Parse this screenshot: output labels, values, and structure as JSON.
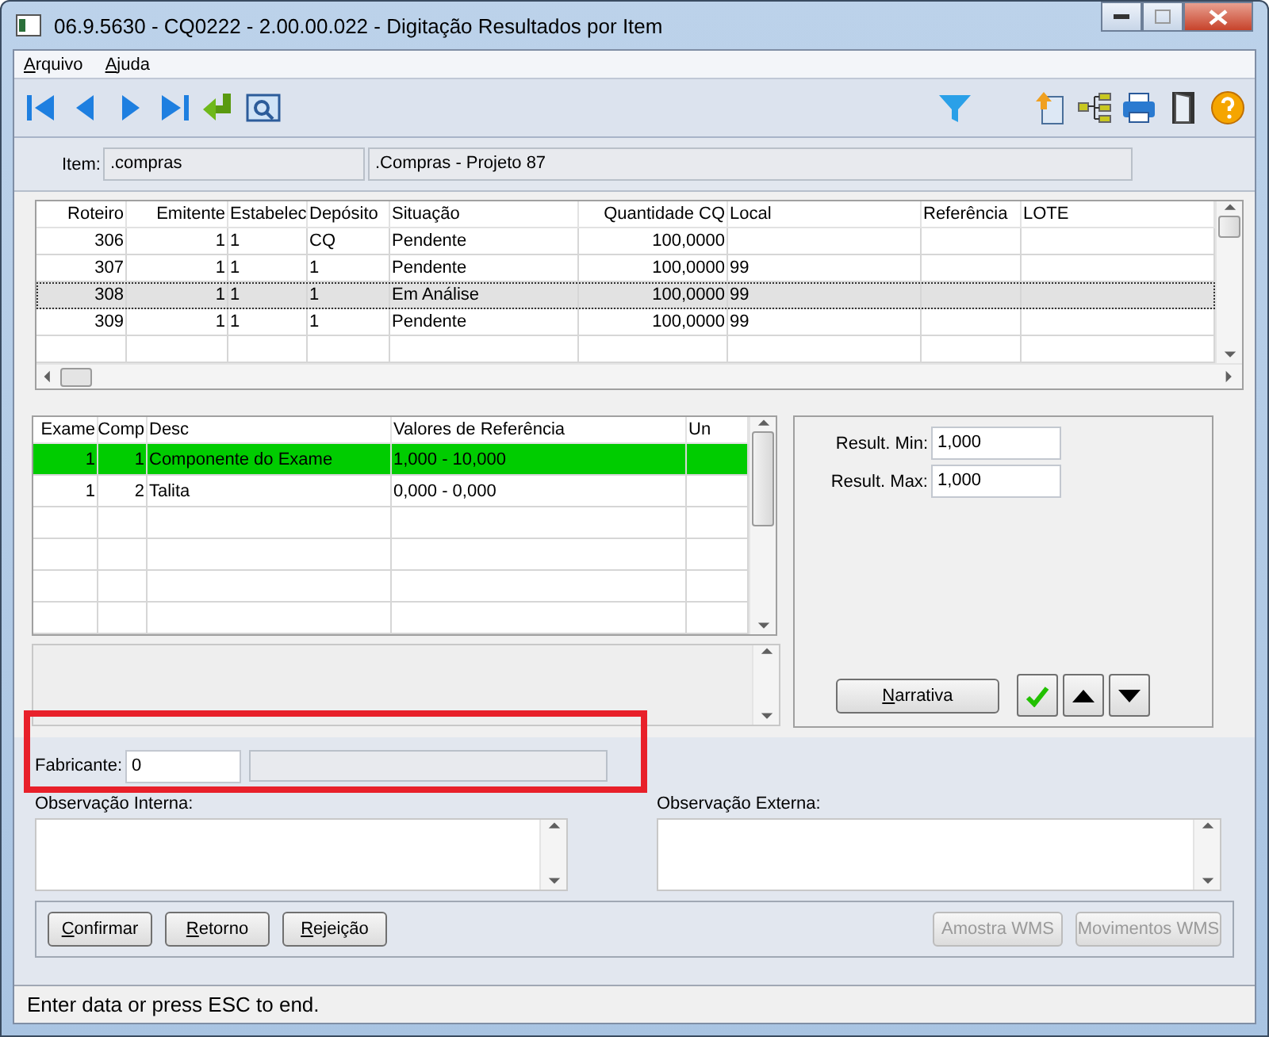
{
  "window": {
    "title": "06.9.5630 - CQ0222 - 2.00.00.022 - Digitação Resultados por Item"
  },
  "menu": [
    {
      "label": "Arquivo"
    },
    {
      "label": "Ajuda"
    }
  ],
  "item": {
    "label": "Item:",
    "code": ".compras",
    "description": ".Compras - Projeto 87"
  },
  "routes_table": {
    "columns": [
      {
        "label": "Roteiro",
        "kind": "number"
      },
      {
        "label": "Emitente",
        "kind": "number"
      },
      {
        "label": "Estabelec",
        "kind": "text"
      },
      {
        "label": "Depósito",
        "kind": "text"
      },
      {
        "label": "Situação",
        "kind": "text"
      },
      {
        "label": "Quantidade CQ",
        "kind": "number"
      },
      {
        "label": "Local",
        "kind": "text"
      },
      {
        "label": "Referência",
        "kind": "text"
      },
      {
        "label": "LOTE",
        "kind": "text"
      }
    ],
    "rows": [
      {
        "cells": [
          "306",
          "1",
          "1",
          "CQ",
          "Pendente",
          "100,0000",
          "",
          "",
          ""
        ],
        "selected": false
      },
      {
        "cells": [
          "307",
          "1",
          "1",
          "1",
          "Pendente",
          "100,0000",
          "99",
          "",
          ""
        ],
        "selected": false
      },
      {
        "cells": [
          "308",
          "1",
          "1",
          "1",
          "Em Análise",
          "100,0000",
          "99",
          "",
          ""
        ],
        "selected": true
      },
      {
        "cells": [
          "309",
          "1",
          "1",
          "1",
          "Pendente",
          "100,0000",
          "99",
          "",
          ""
        ],
        "selected": false
      }
    ]
  },
  "exams_table": {
    "columns": [
      {
        "label": "Exame",
        "kind": "number"
      },
      {
        "label": "Comp",
        "kind": "number"
      },
      {
        "label": "Desc",
        "kind": "text"
      },
      {
        "label": "Valores de Referência",
        "kind": "text"
      },
      {
        "label": "Un",
        "kind": "text"
      }
    ],
    "rows": [
      {
        "cells": [
          "1",
          "1",
          "Componente do Exame",
          "1,000 - 10,000",
          ""
        ],
        "selected": true
      },
      {
        "cells": [
          "1",
          "2",
          "Talita",
          "0,000 - 0,000",
          ""
        ],
        "selected": false
      }
    ]
  },
  "results": [
    {
      "label": "Result. Min:",
      "value": "1,000"
    },
    {
      "label": "Result. Max:",
      "value": "1,000"
    }
  ],
  "narrative_button": "Narrativa",
  "manufacturer": {
    "label": "Fabricante:",
    "value": "0"
  },
  "notes": [
    {
      "label": "Observação Interna:"
    },
    {
      "label": "Observação Externa:"
    }
  ],
  "actions": [
    {
      "label": "Confirmar",
      "disabled": false
    },
    {
      "label": "Retorno",
      "disabled": false
    },
    {
      "label": "Rejeição",
      "disabled": false
    }
  ],
  "wms_actions": [
    {
      "label": "Amostra WMS",
      "disabled": true
    },
    {
      "label": "Movimentos WMS",
      "disabled": true
    }
  ],
  "status_bar": "Enter data or press ESC to end."
}
